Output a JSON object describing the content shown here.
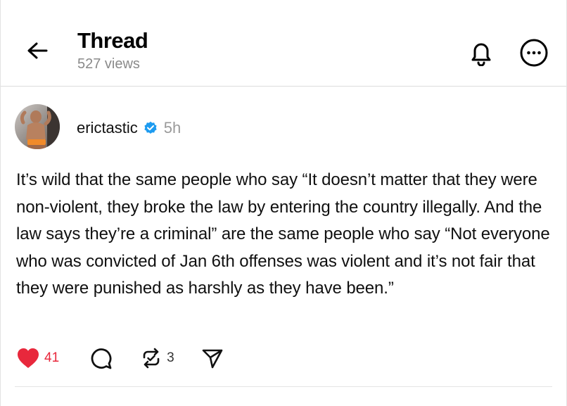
{
  "header": {
    "title": "Thread",
    "views": "527 views"
  },
  "post": {
    "username": "erictastic",
    "timestamp": "5h",
    "text": "It’s wild that the same people who say “It doesn’t matter that they were non-violent, they broke the law by entering the country illegally. And the law says they’re a criminal” are the same people who say “Not everyone who was convicted of Jan 6th offenses was violent and it’s not fair that they were punished as harshly as they have been.”",
    "likes": "41",
    "reposts": "3",
    "liked": true
  },
  "icons": {
    "back": "arrow-left-icon",
    "notifications": "bell-icon",
    "more": "more-dots-icon",
    "verified": "verified-badge-icon",
    "like": "heart-icon",
    "comment": "comment-icon",
    "repost": "repost-icon",
    "share": "share-icon"
  },
  "colors": {
    "like_red": "#e8283c",
    "verified_blue": "#1d9bf0",
    "muted_text": "#8a8a8a"
  }
}
